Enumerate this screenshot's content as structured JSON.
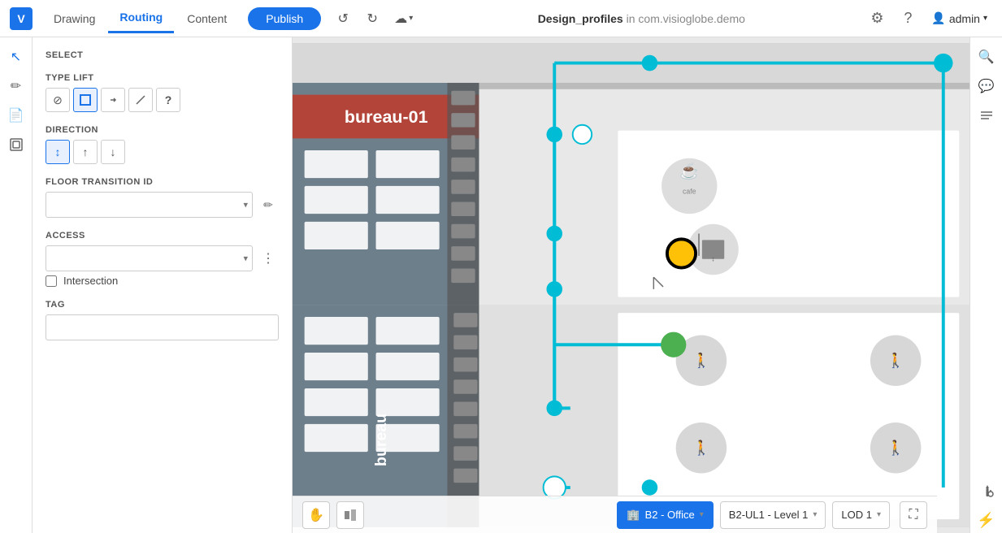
{
  "app": {
    "logo": "V",
    "logo_bg": "#1a73e8"
  },
  "topbar": {
    "tabs": [
      {
        "id": "drawing",
        "label": "Drawing",
        "active": false
      },
      {
        "id": "routing",
        "label": "Routing",
        "active": true
      },
      {
        "id": "content",
        "label": "Content",
        "active": false
      }
    ],
    "publish_label": "Publish",
    "undo_title": "Undo",
    "redo_title": "Redo",
    "cloud_title": "Cloud",
    "title_project": "Design_profiles",
    "title_separator": " in ",
    "title_org": "com.visioglobe.demo",
    "settings_title": "Settings",
    "help_title": "Help",
    "user_icon": "👤",
    "user_name": "admin"
  },
  "sidebar": {
    "select_label": "SELECT",
    "type_lift_label": "TYPE LIFT",
    "type_lift_buttons": [
      {
        "id": "block",
        "icon": "⊘",
        "active": false,
        "title": "Block"
      },
      {
        "id": "square",
        "icon": "□",
        "active": true,
        "title": "Square"
      },
      {
        "id": "link",
        "icon": "🔗",
        "active": false,
        "title": "Link"
      },
      {
        "id": "diagonal",
        "icon": "╱",
        "active": false,
        "title": "Diagonal"
      },
      {
        "id": "info",
        "icon": "?",
        "active": false,
        "title": "Info"
      }
    ],
    "direction_label": "DIRECTION",
    "direction_buttons": [
      {
        "id": "both",
        "icon": "↕",
        "active": true,
        "title": "Both"
      },
      {
        "id": "up",
        "icon": "↑",
        "active": false,
        "title": "Up"
      },
      {
        "id": "down",
        "icon": "↓",
        "active": false,
        "title": "Down"
      }
    ],
    "floor_transition_label": "FLOOR TRANSITION ID",
    "floor_transition_placeholder": "",
    "floor_transition_options": [],
    "access_label": "ACCESS",
    "access_placeholder": "",
    "access_options": [],
    "intersection_label": "Intersection",
    "intersection_checked": false,
    "tag_label": "TAG",
    "tag_placeholder": "",
    "tag_value": ""
  },
  "left_iconbar": {
    "icons": [
      {
        "id": "pointer",
        "symbol": "↖",
        "active": true,
        "title": "Select"
      },
      {
        "id": "pen",
        "symbol": "✏",
        "active": false,
        "title": "Draw"
      },
      {
        "id": "document",
        "symbol": "📄",
        "active": false,
        "title": "Document"
      },
      {
        "id": "layers",
        "symbol": "⊞",
        "active": false,
        "title": "Layers"
      }
    ]
  },
  "right_iconbar": {
    "icons": [
      {
        "id": "search",
        "symbol": "🔍",
        "title": "Search"
      },
      {
        "id": "comment",
        "symbol": "💬",
        "title": "Comment"
      },
      {
        "id": "list",
        "symbol": "≡",
        "title": "List"
      },
      {
        "id": "tools",
        "symbol": "🔧",
        "title": "Tools"
      },
      {
        "id": "lightning",
        "symbol": "⚡",
        "title": "Lightning"
      }
    ]
  },
  "bottom_bar": {
    "hand_tool": "Hand tool",
    "map_tool": "Map tool",
    "floor_label": "B2 - Office",
    "floor_icon": "🏢",
    "level_label": "B2-UL1 - Level 1",
    "lod_label": "LOD 1",
    "fullscreen": "Fullscreen"
  },
  "map": {
    "route_color": "#00bcd4",
    "node_color": "#00bcd4",
    "selected_node_color": "#ffc107",
    "green_node_color": "#4caf50",
    "white_node_color": "#ffffff",
    "building_label": "bureau-01",
    "building_label2": "bureau"
  }
}
